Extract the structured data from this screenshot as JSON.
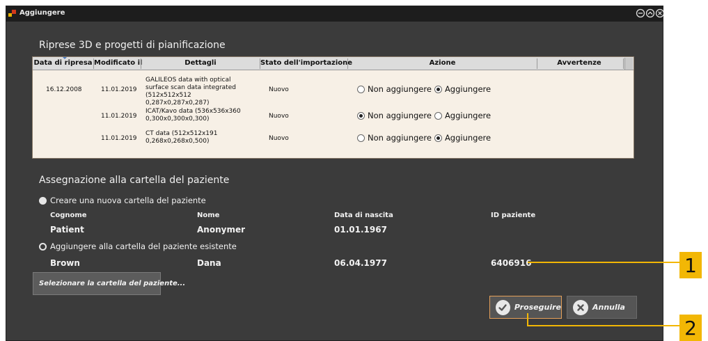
{
  "window": {
    "title": "Aggiungere",
    "controls": [
      "minimize-icon",
      "maximize-icon",
      "close-icon"
    ]
  },
  "scans_section": {
    "title": "Riprese 3D e progetti di pianificazione",
    "columns": [
      "Data di ripresa",
      "Modificato il",
      "Dettagli",
      "Stato dell'importazione",
      "Azione",
      "Avvertenze"
    ],
    "rows": [
      {
        "capture_date": "16.12.2008",
        "modified": "11.01.2019",
        "details": "GALILEOS data with optical surface scan data integrated (512x512x512 0,287x0,287x0,287)",
        "status": "Nuovo",
        "option_a": "Non aggiungere",
        "option_b": "Aggiungere",
        "selected": "Aggiungere"
      },
      {
        "capture_date": "",
        "modified": "11.01.2019",
        "details": "ICAT/Kavo data (536x536x360 0,300x0,300x0,300)",
        "status": "Nuovo",
        "option_a": "Non aggiungere",
        "option_b": "Aggiungere",
        "selected": "Non aggiungere"
      },
      {
        "capture_date": "",
        "modified": "11.01.2019",
        "details": "CT data (512x512x191 0,268x0,268x0,500)",
        "status": "Nuovo",
        "option_a": "Non aggiungere",
        "option_b": "Aggiungere",
        "selected": "Aggiungere"
      }
    ]
  },
  "assignment_section": {
    "title": "Assegnazione alla cartella del paziente",
    "option_new": "Creare una nuova cartella del paziente",
    "option_existing": "Aggiungere alla cartella del paziente esistente",
    "selected": "existing",
    "headers": {
      "surname": "Cognome",
      "name": "Nome",
      "birthdate": "Data di nascita",
      "patient_id": "ID paziente"
    },
    "new_patient": {
      "surname": "Patient",
      "name": "Anonymer",
      "birthdate": "01.01.1967"
    },
    "existing_patient": {
      "surname": "Brown",
      "name": "Dana",
      "birthdate": "06.04.1977",
      "patient_id": "6406916"
    },
    "select_button": "Selezionare la cartella del paziente..."
  },
  "buttons": {
    "continue": "Proseguire",
    "cancel": "Annulla"
  },
  "callouts": [
    "1",
    "2"
  ],
  "colors": {
    "window_bg": "#3b3b3b",
    "titlebar_bg": "#1d1d1d",
    "table_bg": "#f7f0e6",
    "callout": "#f2b705",
    "continue_border": "#e6a15a"
  }
}
